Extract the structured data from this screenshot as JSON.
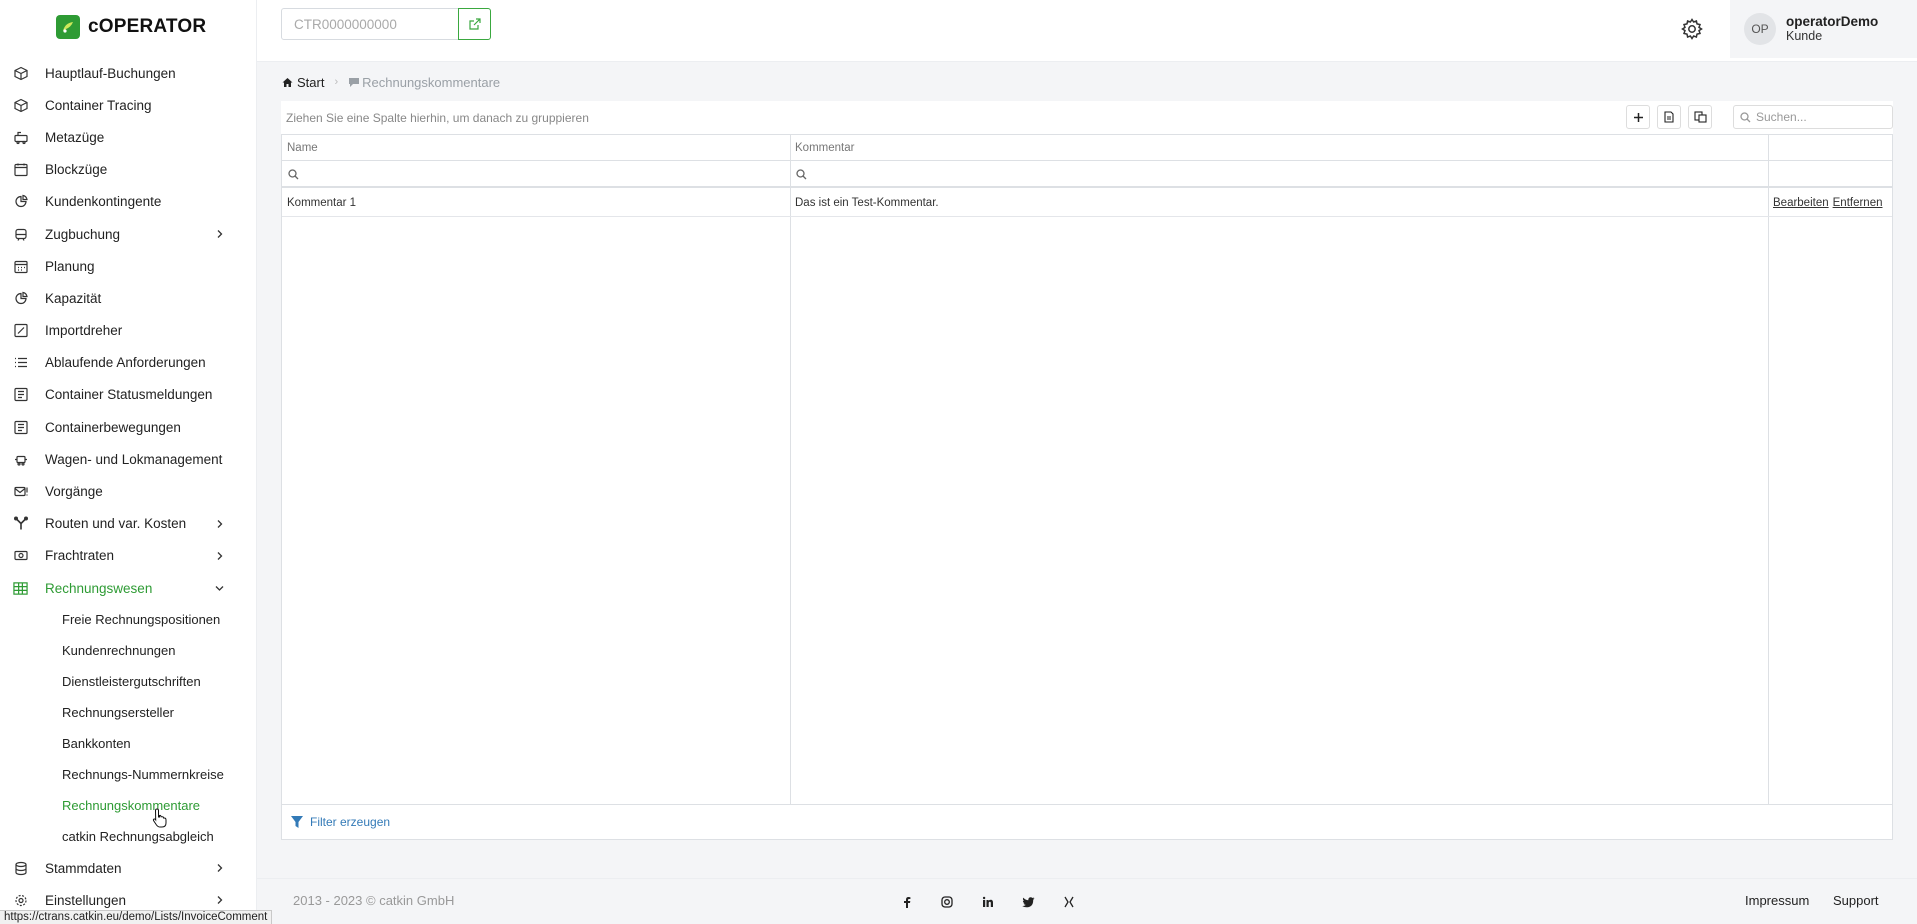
{
  "app": {
    "logo_text": "cOPERATOR"
  },
  "topbar": {
    "ctr_placeholder": "CTR0000000000",
    "user_initials": "OP",
    "user_name": "operatorDemo",
    "user_role": "Kunde"
  },
  "sidebar": {
    "items": [
      {
        "label": "Hauptlauf-Buchungen",
        "icon": "box-icon"
      },
      {
        "label": "Container Tracing",
        "icon": "box-icon"
      },
      {
        "label": "Metazüge",
        "icon": "train-icon"
      },
      {
        "label": "Blockzüge",
        "icon": "calendar-icon"
      },
      {
        "label": "Kundenkontingente",
        "icon": "pie-chart-icon"
      },
      {
        "label": "Zugbuchung",
        "icon": "train-front-icon",
        "chevron": "right"
      },
      {
        "label": "Planung",
        "icon": "calendar-grid-icon"
      },
      {
        "label": "Kapazität",
        "icon": "pie-chart-icon"
      },
      {
        "label": "Importdreher",
        "icon": "edit-square-icon"
      },
      {
        "label": "Ablaufende Anforderungen",
        "icon": "list-icon"
      },
      {
        "label": "Container Statusmeldungen",
        "icon": "report-icon"
      },
      {
        "label": "Containerbewegungen",
        "icon": "report-icon"
      },
      {
        "label": "Wagen- und Lokmanagement",
        "icon": "locomotive-icon"
      },
      {
        "label": "Vorgänge",
        "icon": "mail-alert-icon"
      },
      {
        "label": "Routen und var. Kosten",
        "icon": "route-icon",
        "chevron": "right"
      },
      {
        "label": "Frachtraten",
        "icon": "money-icon",
        "chevron": "right"
      },
      {
        "label": "Rechnungswesen",
        "icon": "grid-icon",
        "chevron": "down",
        "active": true
      }
    ],
    "sub_items": [
      "Freie Rechnungspositionen",
      "Kundenrechnungen",
      "Dienstleistergutschriften",
      "Rechnungsersteller",
      "Bankkonten",
      "Rechnungs-Nummernkreise",
      "Rechnungskommentare",
      "catkin Rechnungsabgleich"
    ],
    "active_sub_index": 6,
    "bottom_items": [
      {
        "label": "Stammdaten",
        "icon": "database-icon",
        "chevron": "right"
      },
      {
        "label": "Einstellungen",
        "icon": "gear-icon",
        "chevron": "right"
      }
    ]
  },
  "breadcrumb": {
    "home": "Start",
    "current": "Rechnungskommentare"
  },
  "grid": {
    "group_hint": "Ziehen Sie eine Spalte hierhin, um danach zu gruppieren",
    "search_placeholder": "Suchen...",
    "columns": [
      "Name",
      "Kommentar",
      ""
    ],
    "rows": [
      {
        "name": "Kommentar 1",
        "kommentar": "Das ist ein Test-Kommentar.",
        "actions": [
          "Bearbeiten",
          "Entfernen"
        ]
      }
    ],
    "filter_label": "Filter erzeugen"
  },
  "footer": {
    "copyright": "2013 - 2023 © catkin GmbH",
    "social_icons": [
      "facebook-icon",
      "instagram-icon",
      "linkedin-icon",
      "twitter-icon",
      "xing-icon"
    ],
    "links": [
      "Impressum",
      "Support"
    ]
  },
  "status_url": "https://ctrans.catkin.eu/demo/Lists/InvoiceComment",
  "colors": {
    "accent": "#2e9b34",
    "link": "#337ab7"
  }
}
